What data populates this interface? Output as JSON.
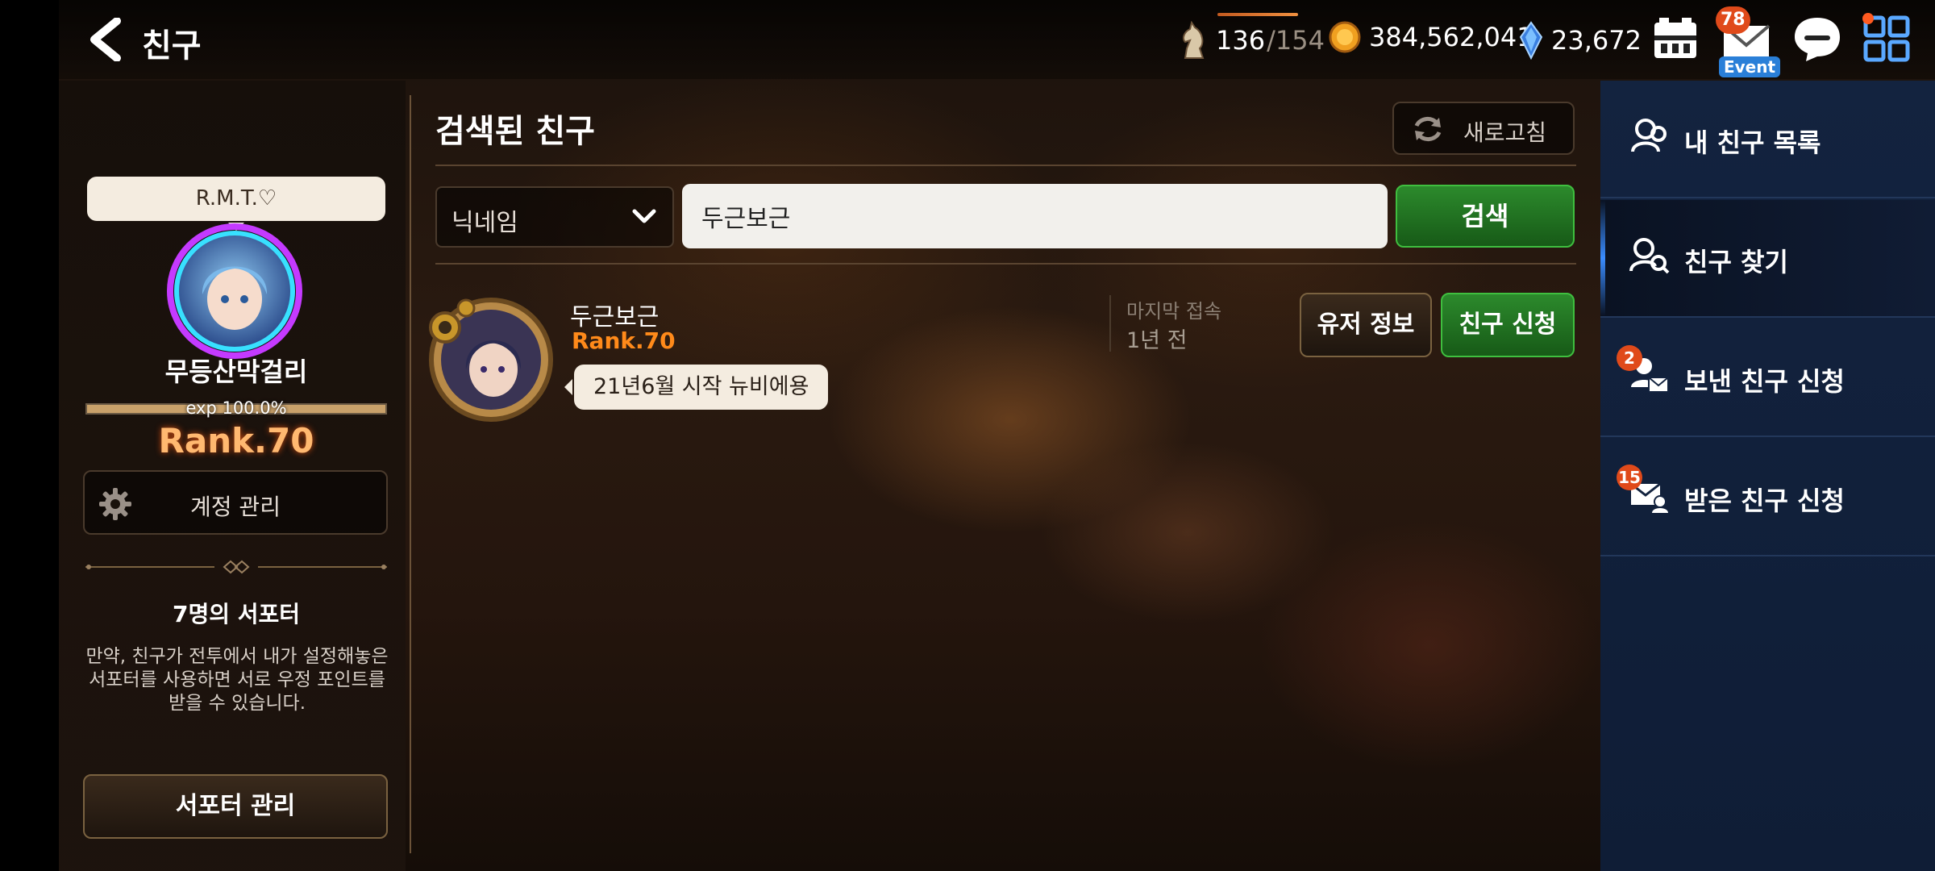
{
  "header": {
    "back_icon": "chevron-left-icon",
    "title": "친구",
    "stamina": {
      "icon": "horse-knight-icon",
      "current": "136",
      "max": "/154"
    },
    "gold": {
      "icon": "gold-coin-icon",
      "value": "384,562,041"
    },
    "crystal": {
      "icon": "blue-crystal-icon",
      "value": "23,672"
    },
    "buttons": {
      "inventory": "chest-icon",
      "mail": {
        "icon": "mail-icon",
        "badge": "78",
        "label": "Event"
      },
      "chat": "chat-bubble-icon",
      "menu": "grid-menu-icon"
    }
  },
  "profile": {
    "title_bubble": "R.M.T.♡",
    "name": "무등산막걸리",
    "exp_text": "exp 100.0%",
    "exp_fraction": 1.0,
    "rank": "Rank.70",
    "account_button": "계정 관리",
    "supporter_title": "7명의 서포터",
    "supporter_desc": "만약, 친구가 전투에서 내가 설정해놓은 서포터를 사용하면 서로 우정 포인트를 받을 수 있습니다.",
    "supporter_button": "서포터 관리"
  },
  "search": {
    "section_title": "검색된 친구",
    "refresh_label": "새로고침",
    "filter_selected": "닉네임",
    "query": "두근보근",
    "search_button": "검색"
  },
  "results": [
    {
      "name": "두근보근",
      "rank": "Rank.70",
      "message": "21년6월 시작 뉴비에용",
      "last_login_label": "마지막 접속",
      "last_login_value": "1년 전",
      "info_button": "유저 정보",
      "request_button": "친구 신청"
    }
  ],
  "nav": {
    "items": [
      {
        "label": "내 친구 목록",
        "icon": "friend-list-icon",
        "badge": ""
      },
      {
        "label": "친구 찾기",
        "icon": "friend-search-icon",
        "badge": "",
        "active": true
      },
      {
        "label": "보낸 친구 신청",
        "icon": "sent-request-icon",
        "badge": "2"
      },
      {
        "label": "받은 친구 신청",
        "icon": "received-request-icon",
        "badge": "15"
      }
    ]
  },
  "colors": {
    "rank_orange": "#ff8a1a",
    "action_green": "#2c8a2c",
    "nav_blue": "#13233f",
    "badge_red": "#e04a1a"
  }
}
